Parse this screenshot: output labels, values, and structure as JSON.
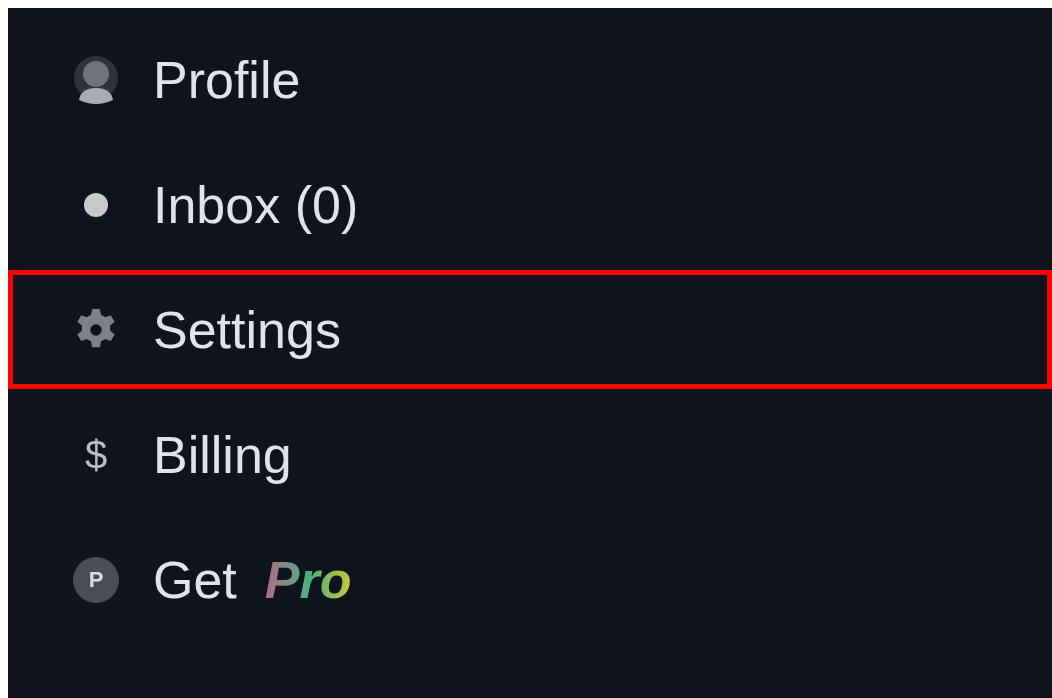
{
  "menu": {
    "items": [
      {
        "kind": "avatar",
        "label": "Profile",
        "selected": false
      },
      {
        "kind": "dot",
        "label": "Inbox (0)",
        "selected": false
      },
      {
        "kind": "gear",
        "label": "Settings",
        "selected": true
      },
      {
        "kind": "glyph",
        "glyph": "$",
        "label": "Billing",
        "selected": false
      },
      {
        "kind": "badge",
        "glyph": "P",
        "label": "Get",
        "highlight": "Pro",
        "selected": false
      }
    ]
  }
}
